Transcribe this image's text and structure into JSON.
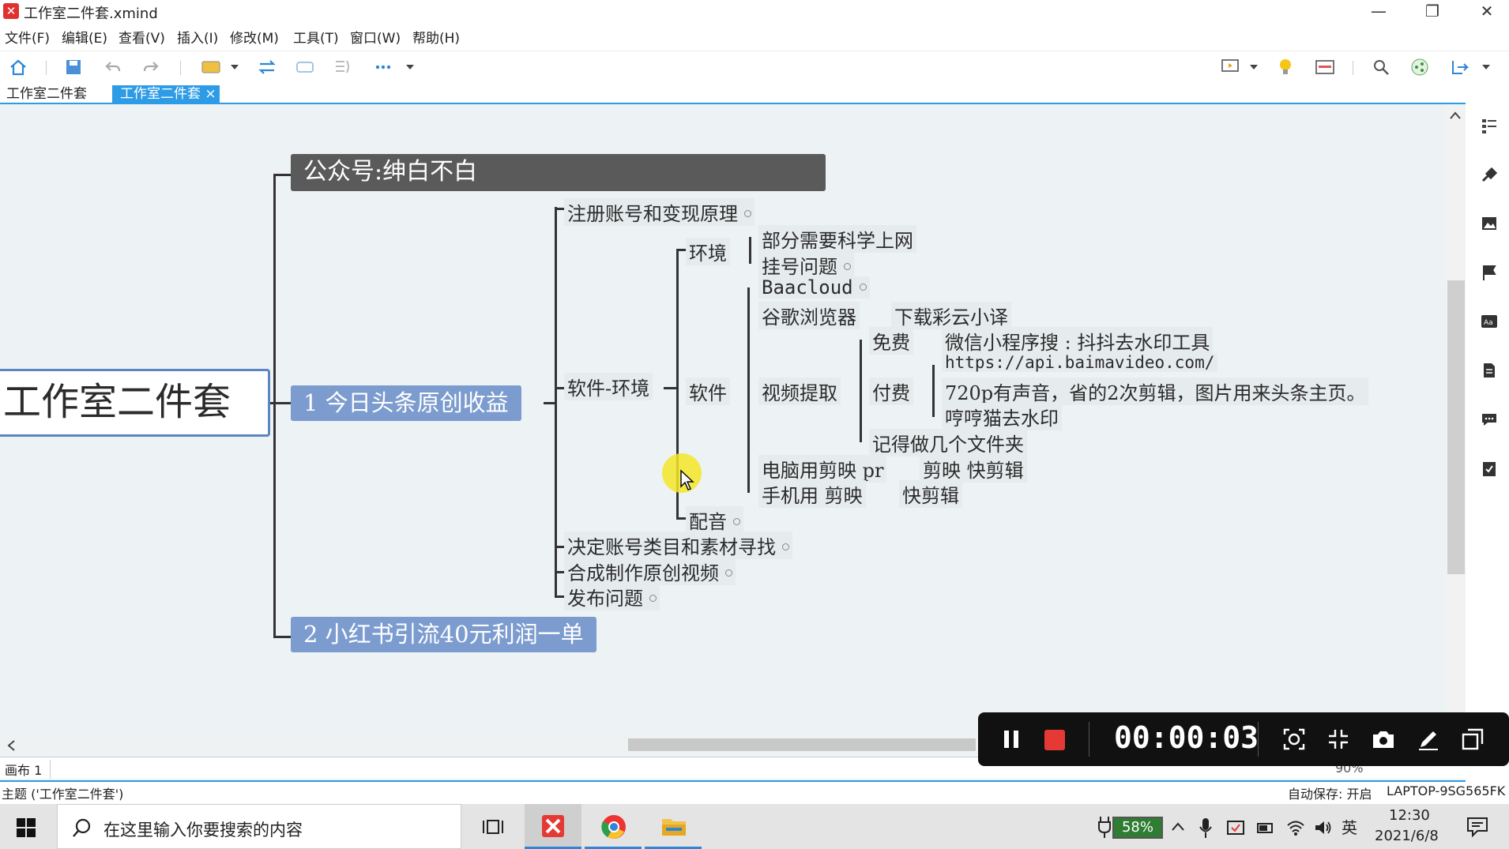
{
  "window": {
    "title": "工作室二件套.xmind",
    "logo_glyph": "✕",
    "minimize": "—",
    "restore": "❐",
    "close": "✕"
  },
  "menu": [
    "文件(F)",
    "编辑(E)",
    "查看(V)",
    "插入(I)",
    "修改(M)",
    "工具(T)",
    "窗口(W)",
    "帮助(H)"
  ],
  "tabs": [
    {
      "label": "工作室二件套"
    },
    {
      "label": "工作室二件套",
      "close": "×"
    }
  ],
  "mindmap": {
    "central": "工作室二件套",
    "header": "公众号:绅白不白",
    "main1": "1 今日头条原创收益",
    "main2": "2 小红书引流40元利润一单",
    "register": "注册账号和变现原理",
    "soft_env": "软件-环境",
    "env": "环境",
    "env_need": "部分需要科学上网",
    "env_hang": "挂号问题",
    "software": "软件",
    "baacloud": "Baacloud",
    "chrome": "谷歌浏览器",
    "chrome_dl": "下载彩云小译",
    "video": "视频提取",
    "free": "免费",
    "free_val": "微信小程序搜 : 抖抖去水印工具",
    "paid": "付费",
    "paid_url": "https://api.baimavideo.com/",
    "paid_720": "720p有声音，省的2次剪辑，图片用来头条主页。",
    "paid_heng": "哼哼猫去水印",
    "folders": "记得做几个文件夹",
    "pc_edit": "电脑用剪映 pr",
    "pc_edit_val": "剪映  快剪辑",
    "phone_edit": "手机用 剪映",
    "phone_edit_val": "快剪辑",
    "dub": "配音",
    "decide": "决定账号类目和素材寻找",
    "compose": "合成制作原创视频",
    "publish": "发布问题"
  },
  "recorder": {
    "time": "00:00:03"
  },
  "sheet": {
    "label": "画布 1",
    "zoom": "90%"
  },
  "status": {
    "topic": "主题 ('工作室二件套')",
    "autosave": "自动保存: 开启",
    "device": "LAPTOP-9SG565FK"
  },
  "taskbar": {
    "search_placeholder": "在这里输入你要搜索的内容",
    "battery": "58%",
    "ime": "英",
    "time": "12:30",
    "date": "2021/6/8"
  },
  "colors": {
    "accent": "#2e9be6",
    "header_bg": "#5a5a5a",
    "main_bg": "#7c9ccf",
    "record_red": "#e53935"
  }
}
